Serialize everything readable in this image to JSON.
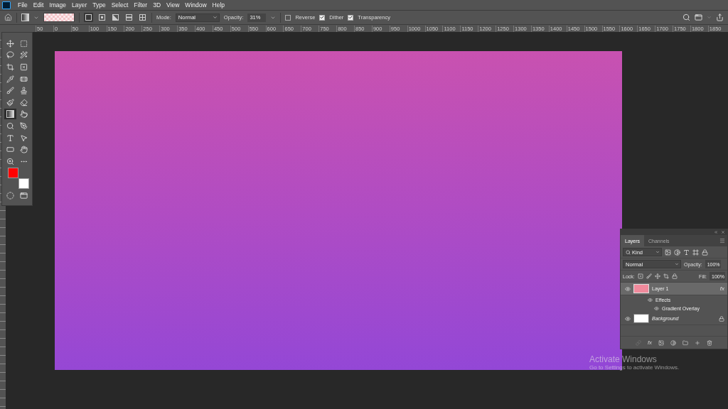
{
  "menu": [
    "File",
    "Edit",
    "Image",
    "Layer",
    "Type",
    "Select",
    "Filter",
    "3D",
    "View",
    "Window",
    "Help"
  ],
  "options": {
    "gradient_types": [
      {
        "selected": true
      },
      {
        "selected": false
      },
      {
        "selected": false
      },
      {
        "selected": false
      },
      {
        "selected": false
      }
    ],
    "mode_label": "Mode:",
    "mode": "Normal",
    "opacity_label": "Opacity:",
    "opacity": "31%",
    "checkboxes": [
      {
        "label": "Reverse",
        "checked": false
      },
      {
        "label": "Dither",
        "checked": true
      },
      {
        "label": "Transparency",
        "checked": true
      }
    ]
  },
  "ruler": [
    "50",
    "0",
    "50",
    "100",
    "150",
    "200",
    "250",
    "300",
    "350",
    "400",
    "450",
    "500",
    "550",
    "600",
    "650",
    "700",
    "750",
    "800",
    "850",
    "900",
    "950",
    "1000",
    "1050",
    "1100",
    "1150",
    "1200",
    "1250",
    "1300",
    "1350",
    "1400",
    "1450",
    "1500",
    "1550",
    "1600",
    "1650",
    "1700",
    "1750",
    "1800",
    "1850"
  ],
  "tools": [
    {
      "kind": "move",
      "selected": false
    },
    {
      "kind": "marquee",
      "selected": false
    },
    {
      "kind": "lasso",
      "selected": false
    },
    {
      "kind": "wand",
      "selected": false
    },
    {
      "kind": "crop",
      "selected": false
    },
    {
      "kind": "frame",
      "selected": false
    },
    {
      "kind": "eyedropper",
      "selected": false
    },
    {
      "kind": "healing",
      "selected": false
    },
    {
      "kind": "brush",
      "selected": false
    },
    {
      "kind": "stamp",
      "selected": false
    },
    {
      "kind": "history",
      "selected": false
    },
    {
      "kind": "eraser",
      "selected": false
    },
    {
      "kind": "gradient",
      "selected": true
    },
    {
      "kind": "smudge",
      "selected": false
    },
    {
      "kind": "dodge",
      "selected": false
    },
    {
      "kind": "pen",
      "selected": false
    },
    {
      "kind": "type",
      "selected": false
    },
    {
      "kind": "path",
      "selected": false
    },
    {
      "kind": "rectangle",
      "selected": false
    },
    {
      "kind": "hand",
      "selected": false
    },
    {
      "kind": "zoom",
      "selected": false
    },
    {
      "kind": "more",
      "selected": false
    }
  ],
  "swatches": [
    {
      "color": "#ff0000"
    },
    {
      "color": "#ffffff"
    }
  ],
  "layers_panel": {
    "tabs": [
      {
        "label": "Layers",
        "selected": true
      },
      {
        "label": "Channels",
        "selected": false
      }
    ],
    "filter": "Kind",
    "blend_mode": "Normal",
    "opacity_label": "Opacity:",
    "opacity": "100%",
    "lock_label": "Lock:",
    "fill_label": "Fill:",
    "fill": "100%",
    "footer_fx": "fx",
    "layers": [
      {
        "name": "Layer 1",
        "selected": true,
        "visible": true,
        "locked": false,
        "fx": "fx",
        "children": [
          {
            "name": "Effects",
            "visible": true
          },
          {
            "name": "Gradient Overlay",
            "visible": true
          }
        ]
      },
      {
        "name": "Background",
        "selected": false,
        "visible": true,
        "locked": true
      }
    ]
  },
  "activation": {
    "title": "Activate Windows",
    "message": "Go to Settings to activate Windows."
  }
}
